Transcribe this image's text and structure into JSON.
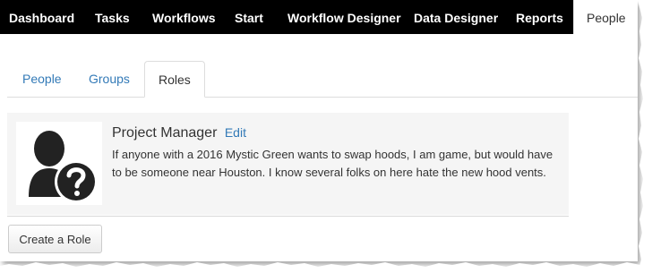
{
  "topnav": {
    "items": [
      {
        "label": "Dashboard"
      },
      {
        "label": "Tasks"
      },
      {
        "label": "Workflows"
      },
      {
        "label": "Start"
      },
      {
        "label": "Workflow Designer"
      },
      {
        "label": "Data Designer"
      },
      {
        "label": "Reports"
      },
      {
        "label": "People",
        "active": true
      }
    ]
  },
  "subtabs": {
    "items": [
      {
        "label": "People"
      },
      {
        "label": "Groups"
      },
      {
        "label": "Roles",
        "active": true
      }
    ]
  },
  "role": {
    "title": "Project Manager",
    "edit_label": "Edit",
    "description": "If anyone with a 2016 Mystic Green wants to swap hoods, I am game, but would have to be someone near Houston. I know several folks on here hate the new hood vents.",
    "avatar_icon": "unknown-user-icon"
  },
  "actions": {
    "create_role_label": "Create a Role"
  },
  "colors": {
    "nav_bg": "#000000",
    "link": "#337ab7",
    "card_bg": "#f5f5f5"
  }
}
